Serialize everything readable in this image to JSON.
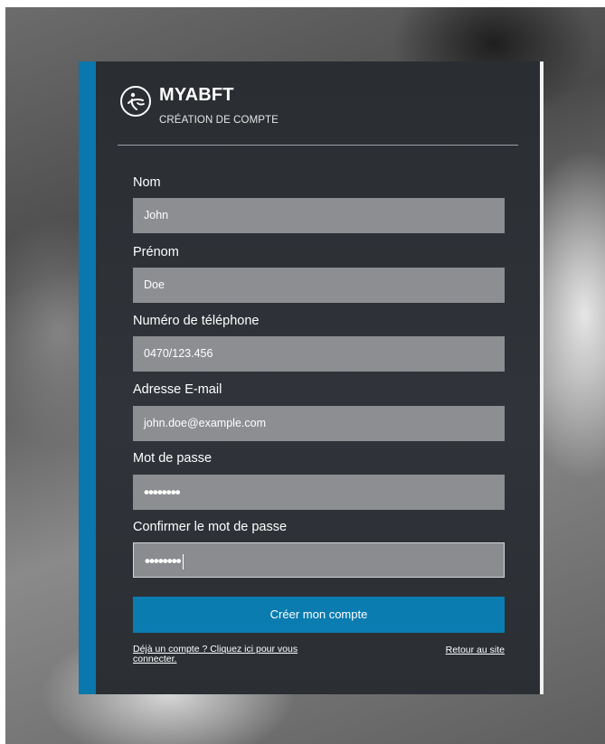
{
  "brand": {
    "name": "MYABFT",
    "subtitle": "CRÉATION DE COMPTE"
  },
  "form": {
    "fields": [
      {
        "label": "Nom",
        "value": "John"
      },
      {
        "label": "Prénom",
        "value": "Doe"
      },
      {
        "label": "Numéro de téléphone",
        "value": "0470/123.456"
      },
      {
        "label": "Adresse E-mail",
        "value": "john.doe@example.com"
      },
      {
        "label": "Mot de passe",
        "value": "••••••••"
      },
      {
        "label": "Confirmer le mot de passe",
        "value": "••••••••"
      }
    ],
    "submit_label": "Créer mon compte",
    "login_link": "Déjà un compte ? Cliquez ici pour vous connecter.",
    "back_link": "Retour au site"
  },
  "colors": {
    "accent": "#0a77ad",
    "card": "#2b2e33",
    "field": "#8c8e91"
  },
  "icons": {
    "logo": "abft-logo-icon"
  }
}
